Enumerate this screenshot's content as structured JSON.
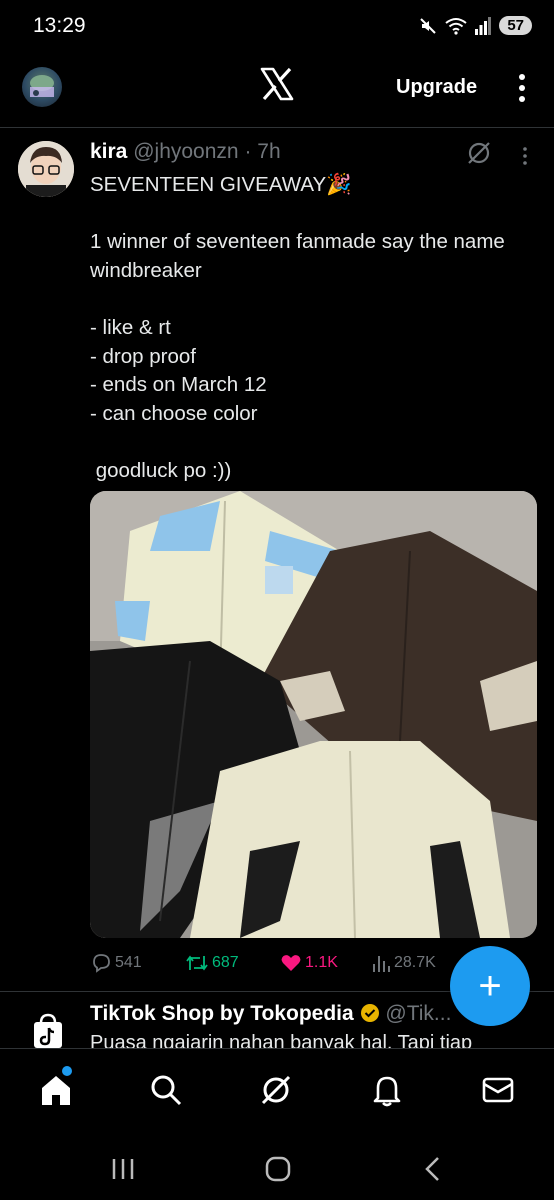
{
  "status_bar": {
    "time": "13:29",
    "battery": "57"
  },
  "top_bar": {
    "logo": "X",
    "upgrade_label": "Upgrade"
  },
  "tweet": {
    "author_name": "kira",
    "handle": "@jhyoonzn",
    "separator": " · ",
    "time": "7h",
    "lines": [
      "SEVENTEEN GIVEAWAY🎉",
      "",
      "1 winner of seventeen fanmade say the name windbreaker",
      "",
      "- like & rt",
      "- drop proof",
      "- ends on March 12",
      "- can choose color",
      "",
      " goodluck po :))"
    ],
    "stats": {
      "replies": "541",
      "reposts": "687",
      "likes": "1.1K",
      "views": "28.7K"
    }
  },
  "tweet2": {
    "author_name": "TikTok Shop by Tokopedia",
    "handle": "@Tik...",
    "text": "Puasa ngajarin nahan banyak hal. Tapi tiap"
  },
  "fab": {
    "label": "+"
  },
  "colors": {
    "accent": "#1d9bf0",
    "repost": "#00ba7c",
    "like": "#f91880",
    "muted": "#71767b"
  }
}
